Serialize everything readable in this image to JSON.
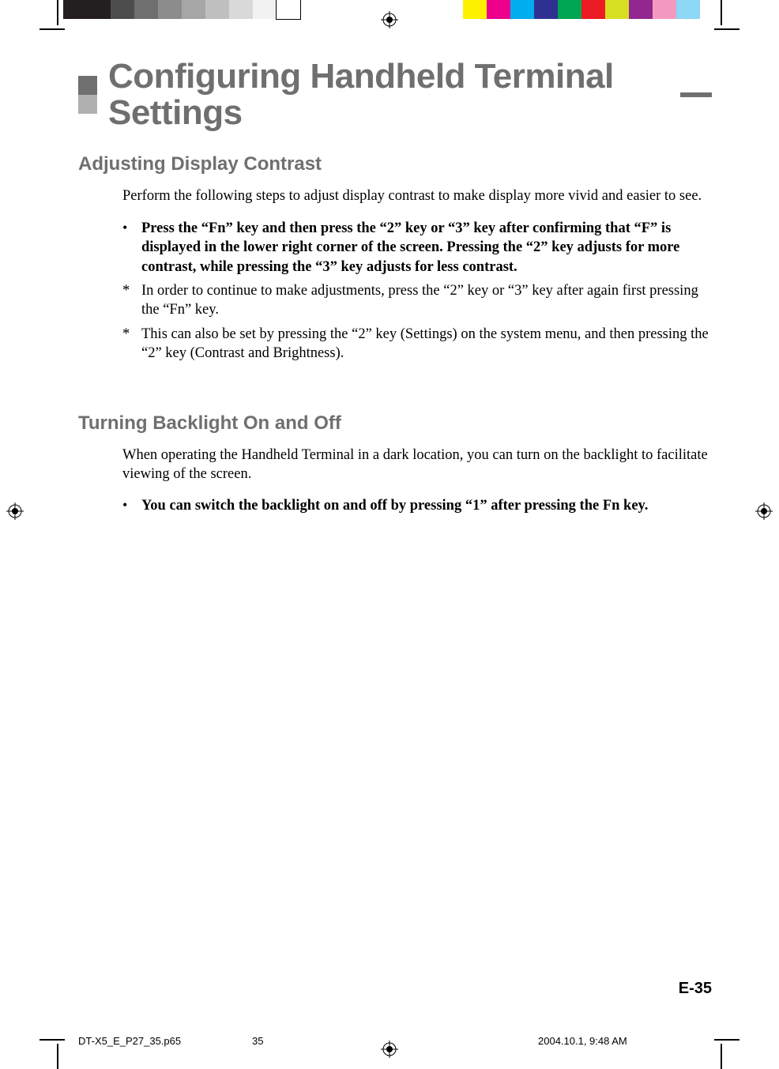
{
  "colorbars": {
    "left": [
      "#231f20",
      "#231f20",
      "#4d4d4d",
      "#6f6f6f",
      "#8c8c8c",
      "#a6a6a6",
      "#bfbfbf",
      "#d9d9d9",
      "#f2f2f2",
      "#ffffff"
    ],
    "right": [
      "#fff200",
      "#ec008c",
      "#00aeef",
      "#2e3192",
      "#00a651",
      "#ed1c24",
      "#d7df23",
      "#92278f",
      "#f49ac1",
      "#8dd7f7"
    ]
  },
  "chapter_title": "Configuring Handheld Terminal Settings",
  "section1": {
    "heading": "Adjusting Display Contrast",
    "intro": "Perform the following steps to adjust display contrast to make display more vivid and easier to see.",
    "bullet": "Press the “Fn” key and then press the “2” key or “3” key after confirming that “F” is displayed in the lower right corner of the screen.  Pressing the “2” key adjusts for more contrast, while pressing the “3” key adjusts for less contrast.",
    "note1": "In order to continue to make adjustments, press the “2” key or “3” key after again first pressing the “Fn” key.",
    "note2": "This can also be set by pressing the “2” key (Settings) on the system menu, and then pressing the “2” key (Contrast and Brightness)."
  },
  "section2": {
    "heading": "Turning Backlight On and Off",
    "intro": "When operating the Handheld Terminal in a dark location, you can turn on the backlight to facilitate viewing of the screen.",
    "bullet": "You can switch the backlight on and off by pressing “1” after pressing the Fn key."
  },
  "page_number": "E-35",
  "footer": {
    "filename": "DT-X5_E_P27_35.p65",
    "page": "35",
    "datetime": "2004.10.1, 9:48 AM"
  },
  "marks": {
    "bullet": "•",
    "star": "*"
  }
}
